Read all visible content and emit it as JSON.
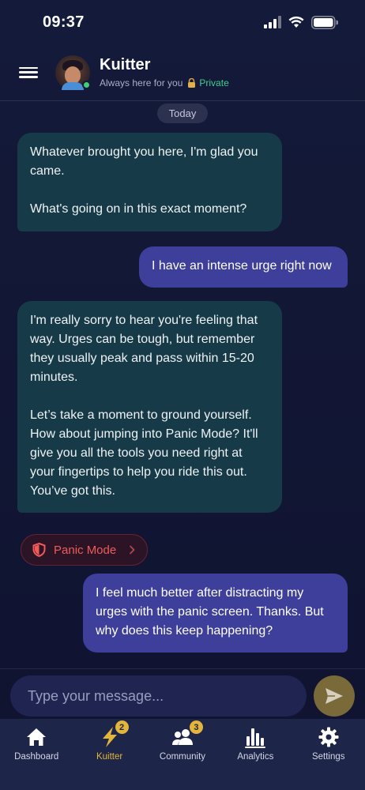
{
  "status_bar": {
    "time": "09:37"
  },
  "header": {
    "title": "Kuitter",
    "subtitle": "Always here for you",
    "privacy_label": "Private"
  },
  "chat": {
    "date_label": "Today",
    "messages": [
      {
        "sender": "bot",
        "text": "Whatever brought you here, I'm glad you came.\n\nWhat's going on in this exact moment?"
      },
      {
        "sender": "user",
        "text": "I have an intense urge right now"
      },
      {
        "sender": "bot",
        "text": "I'm really sorry to hear you're feeling that way. Urges can be tough, but remember they usually peak and pass within 15-20 minutes.\n\nLet’s take a moment to ground yourself. How about jumping into Panic Mode? It'll give you all the tools you need right at your fingertips to help you ride this out. You’ve got this."
      },
      {
        "sender": "user",
        "text": "I feel much better after distracting my urges with the panic screen. Thanks. But why does this keep happening?"
      }
    ],
    "panic_button_label": "Panic Mode"
  },
  "input": {
    "placeholder": "Type your message..."
  },
  "tabs": [
    {
      "label": "Dashboard",
      "icon": "home-icon",
      "active": false,
      "badge": ""
    },
    {
      "label": "Kuitter",
      "icon": "lightning-icon",
      "active": true,
      "badge": "2"
    },
    {
      "label": "Community",
      "icon": "users-icon",
      "active": false,
      "badge": "3"
    },
    {
      "label": "Analytics",
      "icon": "bar-chart-icon",
      "active": false,
      "badge": ""
    },
    {
      "label": "Settings",
      "icon": "gear-icon",
      "active": false,
      "badge": ""
    }
  ],
  "colors": {
    "background": "#141a3a",
    "bot_bubble": "#173a48",
    "user_bubble": "#3d3f9a",
    "accent": "#e3b53a",
    "panic": "#f05a5a",
    "private": "#3ecf8e"
  }
}
